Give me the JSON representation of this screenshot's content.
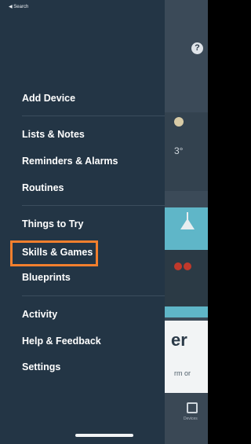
{
  "status_bar": {
    "back_label": "◀ Search"
  },
  "background": {
    "help_icon_glyph": "?",
    "temperature_partial": "3°",
    "card_title_partial": "er",
    "card_sub_partial": "rm or",
    "tab_label": "Devices"
  },
  "menu": {
    "add_device": "Add Device",
    "lists_notes": "Lists & Notes",
    "reminders_alarms": "Reminders & Alarms",
    "routines": "Routines",
    "things_to_try": "Things to Try",
    "skills_games": "Skills & Games",
    "blueprints": "Blueprints",
    "activity": "Activity",
    "help_feedback": "Help & Feedback",
    "settings": "Settings"
  },
  "colors": {
    "drawer_bg": "#233545",
    "highlight": "#f27f2e"
  }
}
